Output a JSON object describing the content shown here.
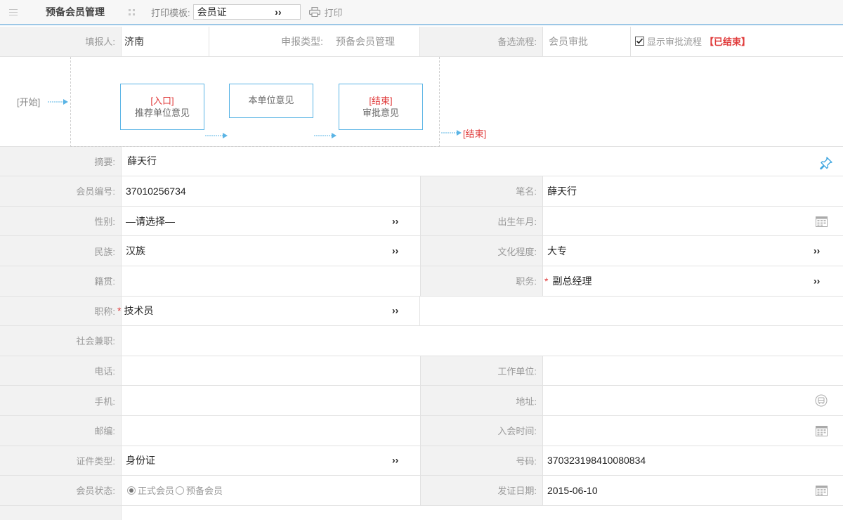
{
  "toolbar": {
    "title": "预备会员管理",
    "print_template_label": "打印模板:",
    "print_template_value": "会员证",
    "print_label": "打印"
  },
  "header": {
    "filler_label": "填报人:",
    "filler_value": "济南",
    "report_type_label": "申报类型:",
    "report_type_value": "预备会员管理",
    "flow_label": "备选流程:",
    "flow_value": "会员审批",
    "show_flow_label": "显示审批流程",
    "flow_status": "【已结束】"
  },
  "flow": {
    "start": "[开始]",
    "end": "[结束]",
    "nodes": [
      {
        "tag": "[入口]",
        "label": "推荐单位意见"
      },
      {
        "tag": "",
        "label": "本单位意见"
      },
      {
        "tag": "[结束]",
        "label": "审批意见"
      }
    ]
  },
  "form": {
    "summary_label": "摘要:",
    "summary_value": "薛天行",
    "member_no_label": "会员编号:",
    "member_no_value": "37010256734",
    "pen_name_label": "笔名:",
    "pen_name_value": "薛天行",
    "gender_label": "性别:",
    "gender_value": "—请选择—",
    "birth_label": "出生年月:",
    "birth_value": "",
    "ethnic_label": "民族:",
    "ethnic_value": "汉族",
    "education_label": "文化程度:",
    "education_value": "大专",
    "native_label": "籍贯:",
    "native_value": "",
    "position_label": "职务:",
    "position_value": "副总经理",
    "title_label": "职称:",
    "title_value": "技术员",
    "social_label": "社会兼职:",
    "social_value": "",
    "phone_label": "电话:",
    "phone_value": "",
    "workplace_label": "工作单位:",
    "workplace_value": "",
    "mobile_label": "手机:",
    "mobile_value": "",
    "address_label": "地址:",
    "address_value": "",
    "postcode_label": "邮编:",
    "postcode_value": "",
    "join_label": "入会时间:",
    "join_value": "",
    "id_type_label": "证件类型:",
    "id_type_value": "身份证",
    "id_no_label": "号码:",
    "id_no_value": "370323198410080834",
    "status_label": "会员状态:",
    "status_option_formal": "正式会员",
    "status_option_reserve": "预备会员",
    "issue_label": "发证日期:",
    "issue_value": "2015-06-10"
  },
  "colors": {
    "accent": "#5ab4e5",
    "danger": "#e03b3b",
    "label_bg": "#f2f2f2"
  }
}
